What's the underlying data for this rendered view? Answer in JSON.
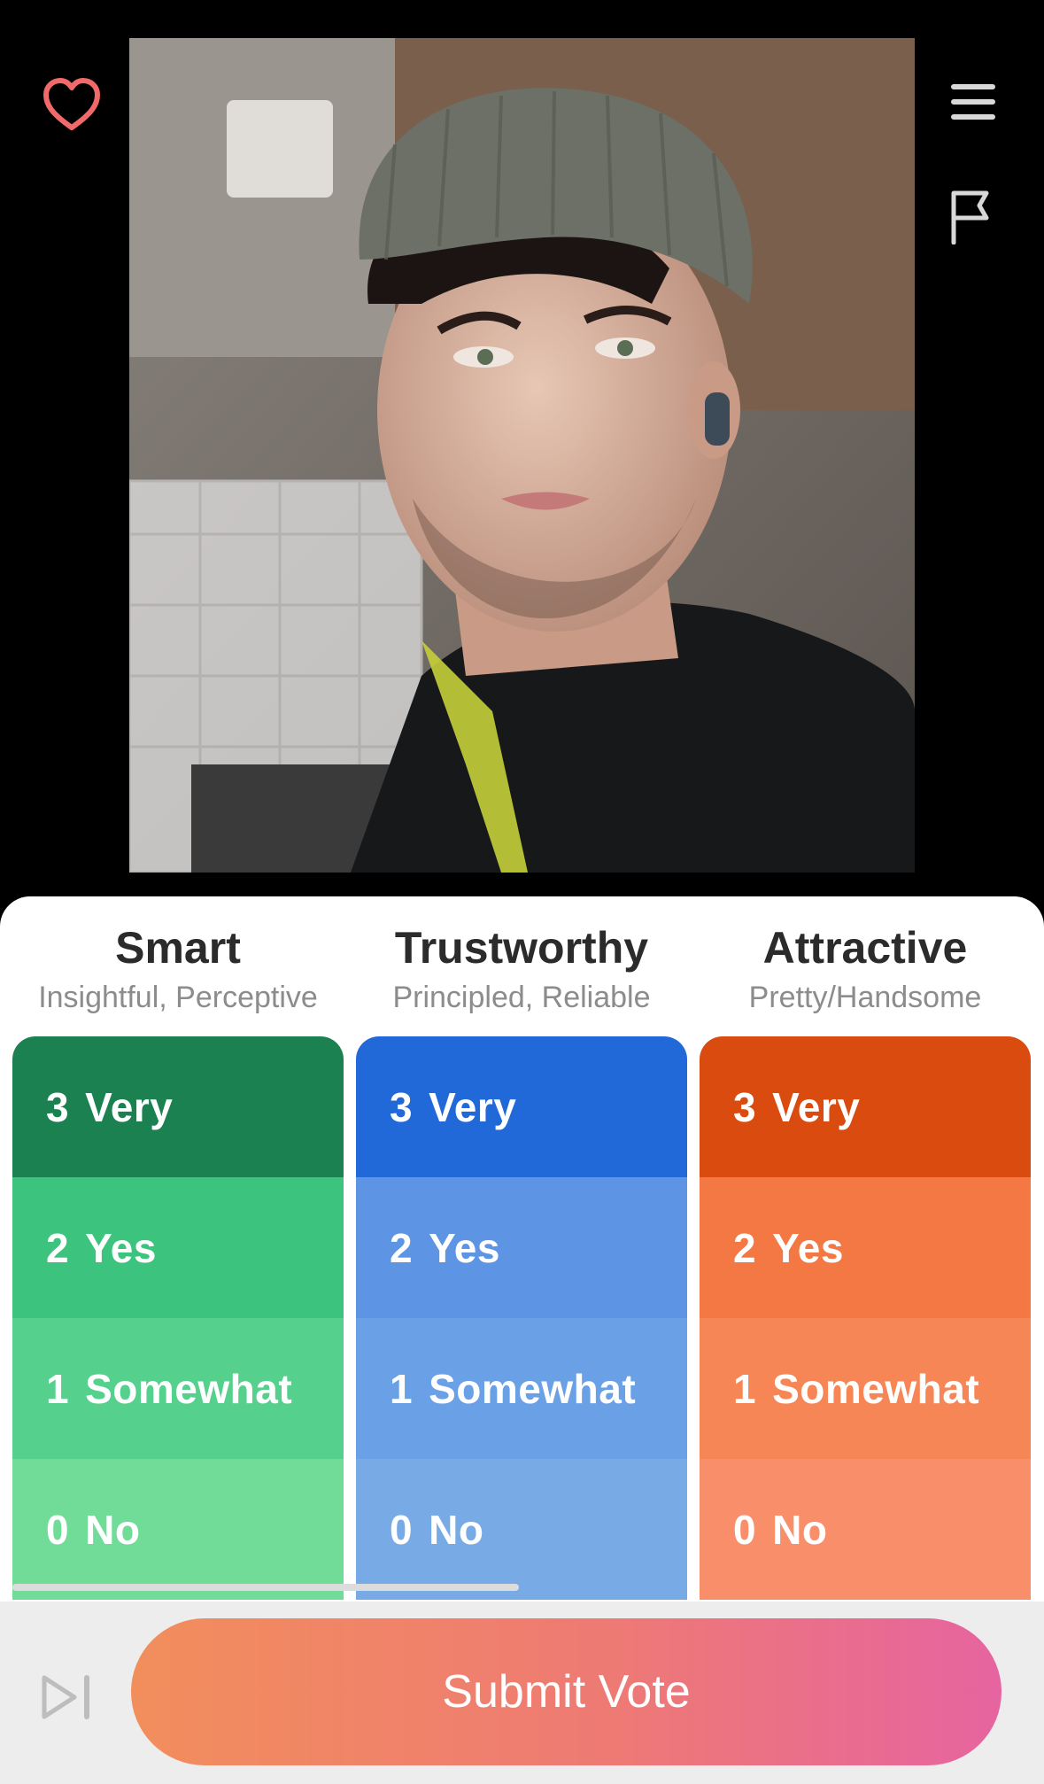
{
  "icons": {
    "heart": "heart-icon",
    "menu": "hamburger-menu-icon",
    "flag": "flag-icon",
    "skip": "skip-next-icon"
  },
  "colors": {
    "heart": "#f06a6a",
    "smart": [
      "#1b8150",
      "#3cc47e",
      "#55d08d",
      "#70dc98"
    ],
    "trustworthy": [
      "#2169d9",
      "#5d95e4",
      "#6aa0e6",
      "#78abe6"
    ],
    "attractive": [
      "#da4b10",
      "#f47843",
      "#f78657",
      "#f98e6b"
    ],
    "submit_gradient": [
      "#f28e5c",
      "#e664a0"
    ]
  },
  "columns": [
    {
      "title": "Smart",
      "subtitle": "Insightful, Perceptive",
      "options": [
        {
          "num": "3",
          "label": "Very"
        },
        {
          "num": "2",
          "label": "Yes"
        },
        {
          "num": "1",
          "label": "Somewhat"
        },
        {
          "num": "0",
          "label": "No"
        }
      ]
    },
    {
      "title": "Trustworthy",
      "subtitle": "Principled, Reliable",
      "options": [
        {
          "num": "3",
          "label": "Very"
        },
        {
          "num": "2",
          "label": "Yes"
        },
        {
          "num": "1",
          "label": "Somewhat"
        },
        {
          "num": "0",
          "label": "No"
        }
      ]
    },
    {
      "title": "Attractive",
      "subtitle": "Pretty/Handsome",
      "options": [
        {
          "num": "3",
          "label": "Very"
        },
        {
          "num": "2",
          "label": "Yes"
        },
        {
          "num": "1",
          "label": "Somewhat"
        },
        {
          "num": "0",
          "label": "No"
        }
      ]
    }
  ],
  "submit_label": "Submit Vote"
}
